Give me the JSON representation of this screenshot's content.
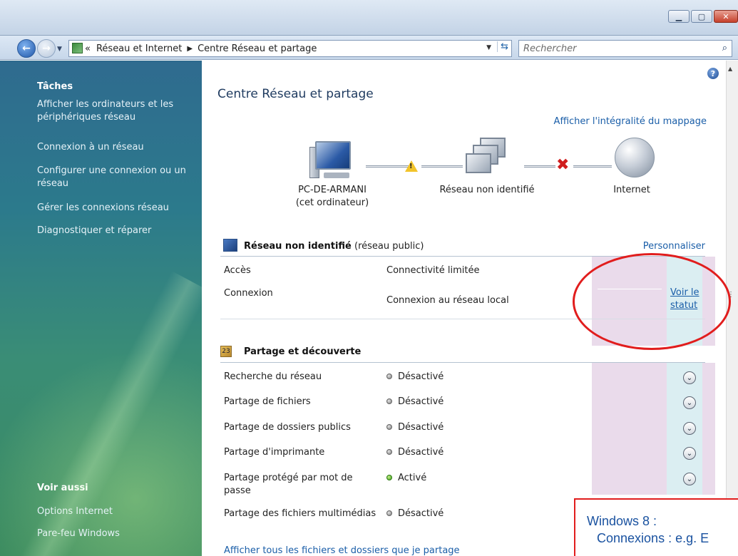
{
  "window": {
    "minimize_icon": "minimize-icon",
    "maximize_icon": "maximize-icon",
    "close_icon": "close-icon"
  },
  "navbar": {
    "back_icon": "back-arrow-icon",
    "forward_icon": "forward-arrow-icon",
    "history_prefix": "«",
    "breadcrumbs": [
      "Réseau et Internet",
      "Centre Réseau et partage"
    ],
    "search_placeholder": "Rechercher"
  },
  "sidebar": {
    "tasks_heading": "Tâches",
    "tasks": [
      "Afficher les ordinateurs et les périphériques réseau",
      "Connexion à un réseau",
      "Configurer une connexion ou un réseau",
      "Gérer les connexions réseau",
      "Diagnostiquer et réparer"
    ],
    "see_also_heading": "Voir aussi",
    "see_also": [
      "Options Internet",
      "Pare-feu Windows"
    ]
  },
  "main": {
    "title": "Centre Réseau et partage",
    "full_map_link": "Afficher l'intégralité du mappage",
    "map": {
      "computer_name": "PC-DE-ARMANI",
      "computer_sub": "(cet ordinateur)",
      "network_name": "Réseau non identifié",
      "internet": "Internet"
    },
    "network_section": {
      "name": "Réseau non identifié",
      "type": "(réseau public)",
      "customize": "Personnaliser",
      "rows": [
        {
          "label": "Accès",
          "value": "Connectivité limitée"
        },
        {
          "label": "Connexion",
          "value": "Connexion au réseau local"
        }
      ],
      "status_link": "Voir le statut"
    },
    "sharing_section": {
      "title": "Partage et découverte",
      "rows": [
        {
          "label": "Recherche du réseau",
          "value": "Désactivé",
          "on": false
        },
        {
          "label": "Partage de fichiers",
          "value": "Désactivé",
          "on": false
        },
        {
          "label": "Partage de dossiers publics",
          "value": "Désactivé",
          "on": false
        },
        {
          "label": "Partage d'imprimante",
          "value": "Désactivé",
          "on": false
        },
        {
          "label": "Partage protégé par mot de passe",
          "value": "Activé",
          "on": true
        },
        {
          "label": "Partage des fichiers multimédias",
          "value": "Désactivé",
          "on": false
        }
      ]
    },
    "bottom_link": "Afficher tous les fichiers et dossiers que je partage"
  },
  "annotation": {
    "line1": "Windows 8 :",
    "line2": "Connexions : e.g. E"
  },
  "colors": {
    "sidebar": "#2f6b8f",
    "link": "#1a5ea8",
    "annotation_red": "#e11d1d",
    "annotation_text": "#1a52a0",
    "pink_column": "#eadbeb",
    "blue_column": "#dbeef2"
  }
}
